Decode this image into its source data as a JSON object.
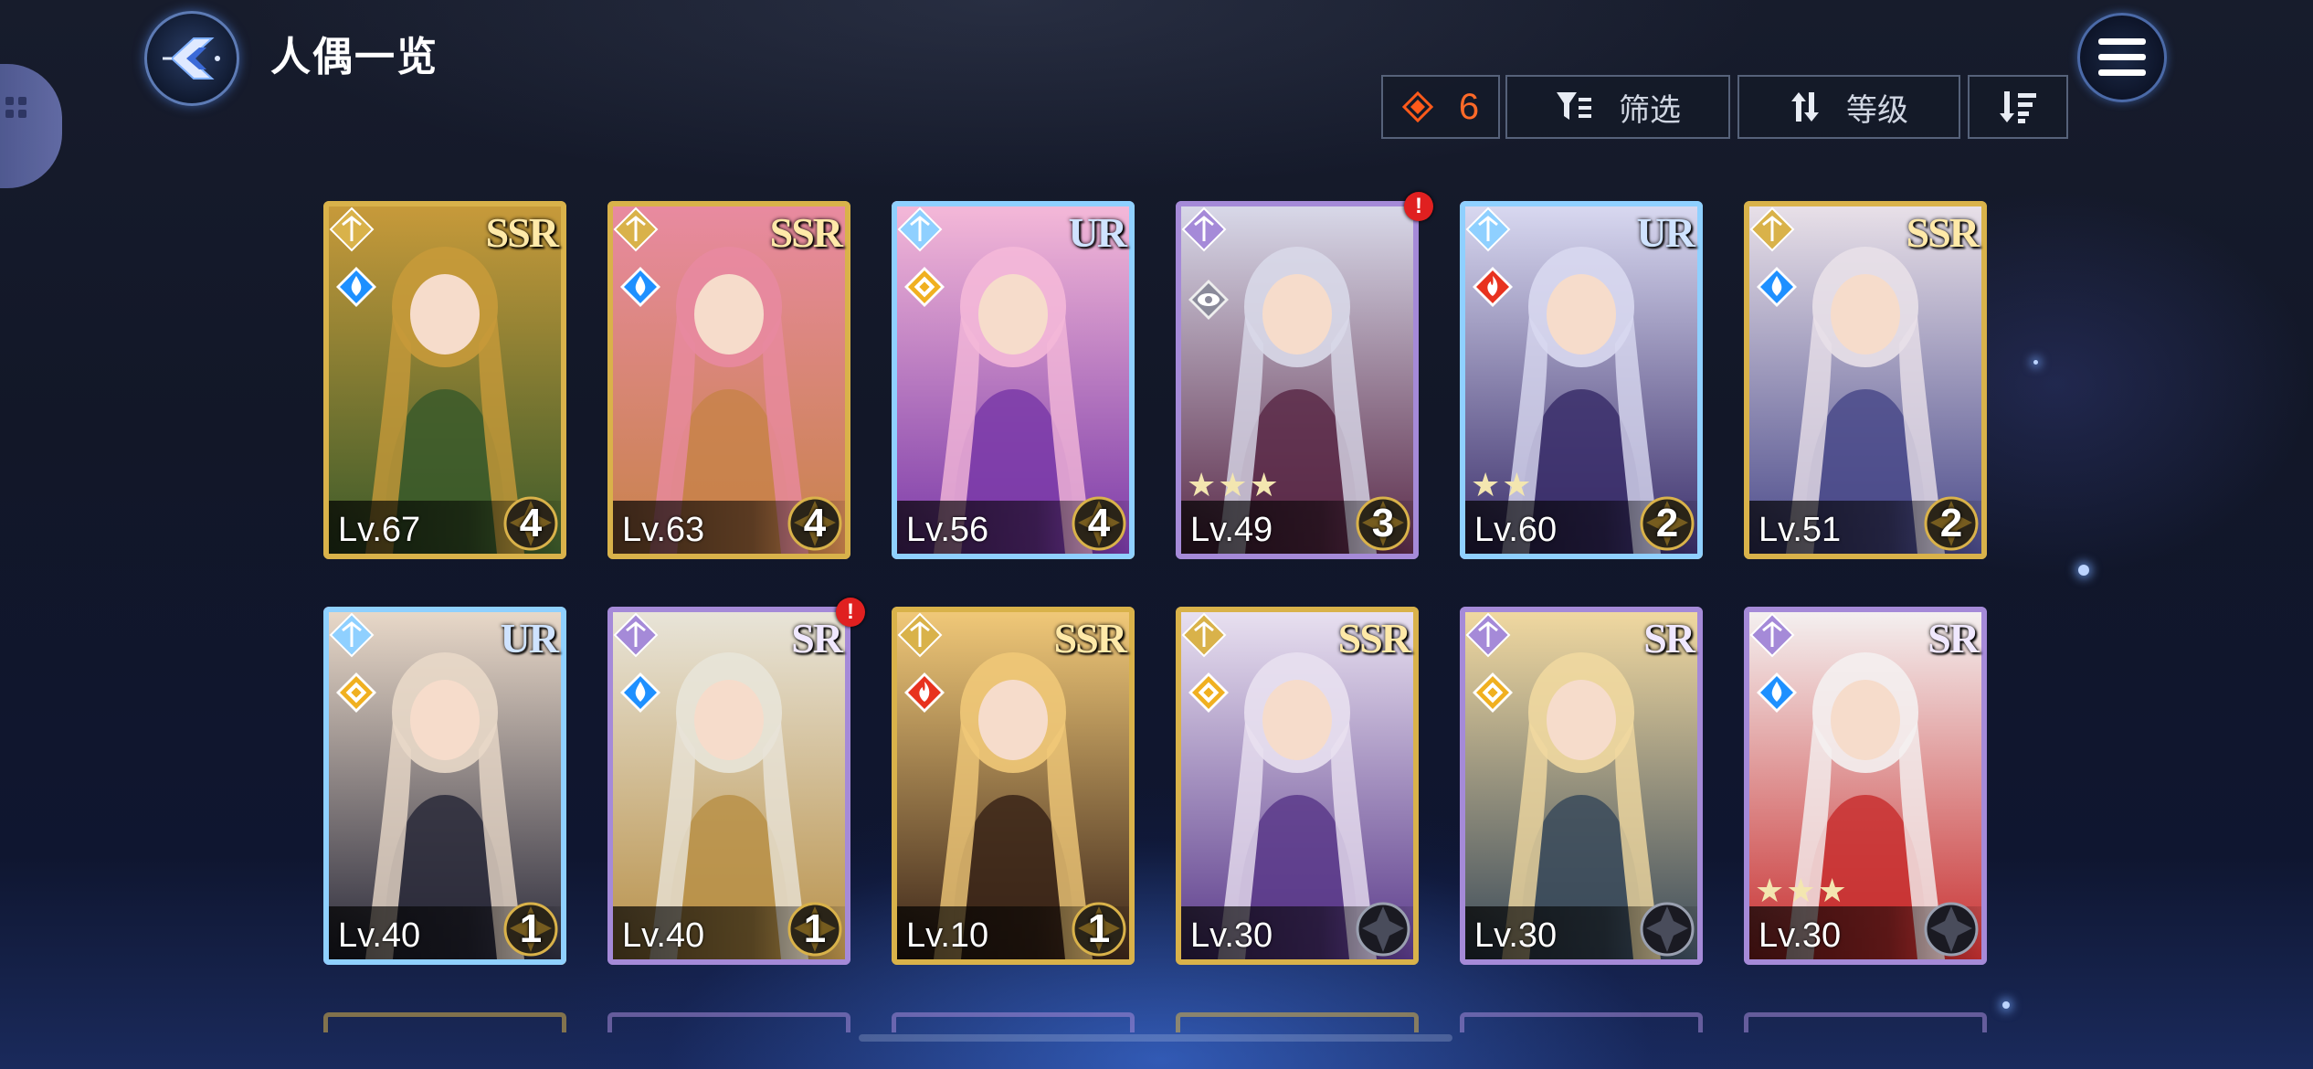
{
  "header": {
    "title": "人偶一览"
  },
  "toolbar": {
    "gem_count": "6",
    "filter_label": "筛选",
    "sort_label": "等级"
  },
  "colors": {
    "gold": "#d9b24a",
    "purple": "#a58ad8",
    "rainbow": "#8fd0ff",
    "water": "#1e90ff",
    "fire": "#e8321e",
    "light": "#f0b020",
    "dark": "#8a8a9a",
    "gem": "#ff5a1a"
  },
  "cards": [
    {
      "rarity": "SSR",
      "level": "Lv.67",
      "grade": "4",
      "frame": "gold",
      "element": "water",
      "stars": "",
      "bg1": "#c79a3a",
      "bg2": "#3b5a2a",
      "alert": false
    },
    {
      "rarity": "SSR",
      "level": "Lv.63",
      "grade": "4",
      "frame": "gold",
      "element": "water",
      "stars": "",
      "bg1": "#e88aa0",
      "bg2": "#c8824a",
      "alert": false
    },
    {
      "rarity": "UR",
      "level": "Lv.56",
      "grade": "4",
      "frame": "rainbow",
      "element": "light",
      "stars": "",
      "bg1": "#f4b8d8",
      "bg2": "#7a3aa8",
      "alert": false
    },
    {
      "rarity": "",
      "level": "Lv.49",
      "grade": "3",
      "frame": "purple",
      "element": "dark",
      "stars": "★★★",
      "bg1": "#d8d8e8",
      "bg2": "#5a2a48",
      "alert": true
    },
    {
      "rarity": "UR",
      "level": "Lv.60",
      "grade": "2",
      "frame": "rainbow",
      "element": "fire",
      "stars": "★★",
      "bg1": "#d8d8f0",
      "bg2": "#3a2e6a",
      "alert": false
    },
    {
      "rarity": "SSR",
      "level": "Lv.51",
      "grade": "2",
      "frame": "gold",
      "element": "water",
      "stars": "",
      "bg1": "#e8e0e8",
      "bg2": "#4a4a8a",
      "alert": false
    },
    {
      "rarity": "UR",
      "level": "Lv.40",
      "grade": "1",
      "frame": "rainbow",
      "element": "light",
      "stars": "",
      "bg1": "#e8d8c8",
      "bg2": "#2a2a3a",
      "alert": false
    },
    {
      "rarity": "SR",
      "level": "Lv.40",
      "grade": "1",
      "frame": "purple",
      "element": "water",
      "stars": "",
      "bg1": "#e8e4d8",
      "bg2": "#b89048",
      "alert": true
    },
    {
      "rarity": "SSR",
      "level": "Lv.10",
      "grade": "1",
      "frame": "gold",
      "element": "fire",
      "stars": "",
      "bg1": "#f0c878",
      "bg2": "#3a2418",
      "alert": false
    },
    {
      "rarity": "SSR",
      "level": "Lv.30",
      "grade": "",
      "frame": "gold",
      "element": "light",
      "stars": "",
      "bg1": "#e8e0f0",
      "bg2": "#5a3a8a",
      "alert": false
    },
    {
      "rarity": "SR",
      "level": "Lv.30",
      "grade": "",
      "frame": "purple",
      "element": "light",
      "stars": "",
      "bg1": "#f0d8a0",
      "bg2": "#3a4a5a",
      "alert": false
    },
    {
      "rarity": "SR",
      "level": "Lv.30",
      "grade": "",
      "frame": "purple",
      "element": "water",
      "stars": "★★★",
      "bg1": "#f4f0f0",
      "bg2": "#c83030",
      "alert": false
    }
  ]
}
